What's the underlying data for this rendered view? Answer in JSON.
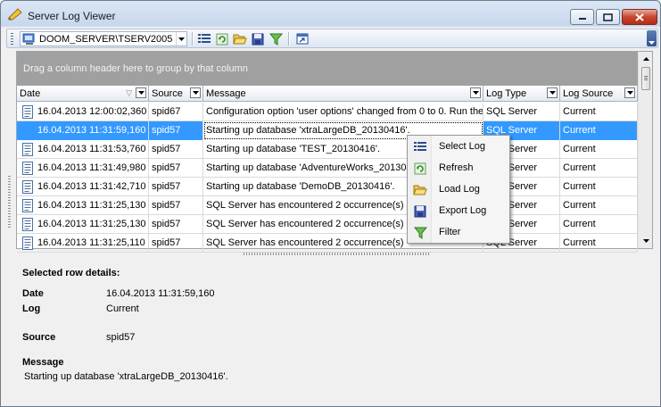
{
  "window": {
    "title": "Server Log Viewer"
  },
  "toolbar": {
    "server": "DOOM_SERVER\\TSERV2005",
    "buttons": [
      "select-log",
      "refresh",
      "load-log",
      "export-log",
      "filter",
      "extra-window"
    ]
  },
  "grid": {
    "group_hint": "Drag a column header here to group by that column",
    "columns": [
      "Date",
      "Source",
      "Message",
      "Log Type",
      "Log Source"
    ],
    "rows": [
      {
        "date": "16.04.2013 12:00:02,360",
        "source": "spid67",
        "message": "Configuration option 'user options' changed from 0 to 0. Run the",
        "log_type": "SQL Server",
        "log_source": "Current",
        "selected": false
      },
      {
        "date": "16.04.2013 11:31:59,160",
        "source": "spid57",
        "message": "Starting up database 'xtraLargeDB_20130416'.",
        "log_type": "SQL Server",
        "log_source": "Current",
        "selected": true
      },
      {
        "date": "16.04.2013 11:31:53,760",
        "source": "spid57",
        "message": "Starting up database 'TEST_20130416'.",
        "log_type": "SQL Server",
        "log_source": "Current",
        "selected": false
      },
      {
        "date": "16.04.2013 11:31:49,980",
        "source": "spid57",
        "message": "Starting up database 'AdventureWorks_201304",
        "log_type": "SQL Server",
        "log_source": "Current",
        "selected": false
      },
      {
        "date": "16.04.2013 11:31:42,710",
        "source": "spid57",
        "message": "Starting up database 'DemoDB_20130416'.",
        "log_type": "SQL Server",
        "log_source": "Current",
        "selected": false
      },
      {
        "date": "16.04.2013 11:31:25,130",
        "source": "spid57",
        "message": "SQL Server has encountered 2 occurrence(s)",
        "log_type": "SQL Server",
        "log_source": "Current",
        "selected": false
      },
      {
        "date": "16.04.2013 11:31:25,130",
        "source": "spid57",
        "message": "SQL Server has encountered 2 occurrence(s)",
        "log_type": "SQL Server",
        "log_source": "Current",
        "selected": false
      },
      {
        "date": "16.04.2013 11:31:25,110",
        "source": "spid57",
        "message": "SQL Server has encountered 2 occurrence(s)",
        "log_type": "SQL Server",
        "log_source": "Current",
        "selected": false
      }
    ]
  },
  "context_menu": {
    "items": [
      "Select Log",
      "Refresh",
      "Load Log",
      "Export Log",
      "Filter"
    ]
  },
  "details": {
    "title": "Selected row details:",
    "date_label": "Date",
    "date_value": "16.04.2013 11:31:59,160",
    "log_label": "Log",
    "log_value": "Current",
    "source_label": "Source",
    "source_value": "spid57",
    "message_label": "Message",
    "message_value": "Starting up database 'xtraLargeDB_20130416'."
  }
}
